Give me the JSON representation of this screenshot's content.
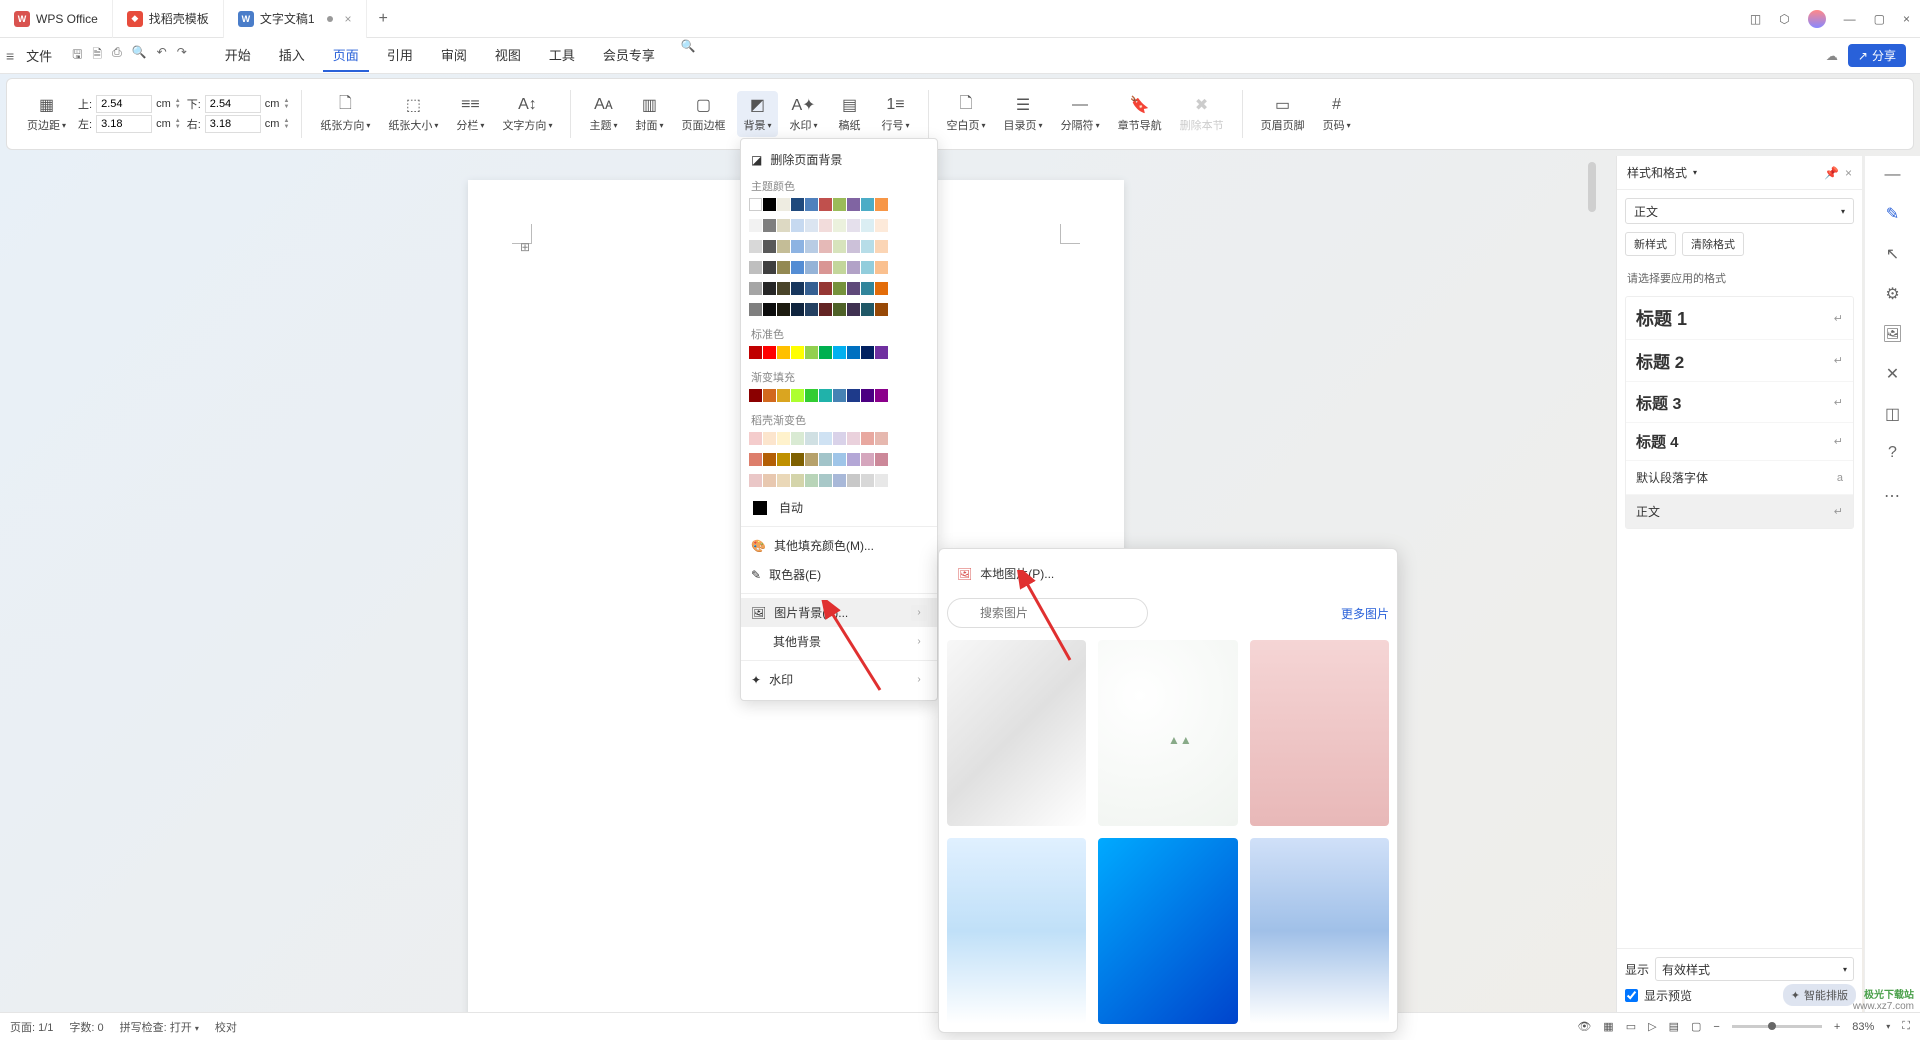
{
  "titlebar": {
    "tabs": [
      {
        "icon": "W",
        "label": "WPS Office"
      },
      {
        "icon": "D",
        "label": "找稻壳模板"
      },
      {
        "icon": "W",
        "label": "文字文稿1",
        "active": true,
        "dirty": true
      }
    ]
  },
  "menubar": {
    "file": "文件",
    "tabs": [
      "开始",
      "插入",
      "页面",
      "引用",
      "审阅",
      "视图",
      "工具",
      "会员专享"
    ],
    "active": "页面",
    "share": "分享"
  },
  "ribbon": {
    "margins": {
      "label": "页边距",
      "top_label": "上:",
      "top": "2.54",
      "unit": "cm",
      "bottom_label": "下:",
      "bottom": "2.54",
      "left_label": "左:",
      "left": "3.18",
      "right_label": "右:",
      "right": "3.18"
    },
    "items": {
      "paper_dir": "纸张方向",
      "paper_size": "纸张大小",
      "columns": "分栏",
      "text_dir": "文字方向",
      "theme": "主题",
      "cover": "封面",
      "page_border": "页面边框",
      "background": "背景",
      "watermark": "水印",
      "paper": "稿纸",
      "line_no": "行号",
      "blank_page": "空白页",
      "toc_page": "目录页",
      "separator": "分隔符",
      "chapter_nav": "章节导航",
      "delete_section": "删除本节",
      "header_footer": "页眉页脚",
      "page_no": "页码"
    }
  },
  "bg_dropdown": {
    "delete_bg": "删除页面背景",
    "theme_colors": "主题颜色",
    "standard_colors": "标准色",
    "gradient": "渐变填充",
    "docer_gradient": "稻壳渐变色",
    "auto": "自动",
    "other_fill": "其他填充颜色(M)...",
    "eyedropper": "取色器(E)",
    "picture_bg": "图片背景(P)...",
    "other_bg": "其他背景",
    "watermark": "水印"
  },
  "img_submenu": {
    "local_pic": "本地图片(P)...",
    "search_placeholder": "搜索图片",
    "more": "更多图片"
  },
  "right_panel": {
    "title": "样式和格式",
    "current_style": "正文",
    "new_style": "新样式",
    "clear_format": "清除格式",
    "hint": "请选择要应用的格式",
    "styles": [
      {
        "name": "标题 1",
        "cls": "h1"
      },
      {
        "name": "标题 2",
        "cls": "h2"
      },
      {
        "name": "标题 3",
        "cls": "h3"
      },
      {
        "name": "标题 4",
        "cls": "h4"
      },
      {
        "name": "默认段落字体",
        "cls": "def",
        "ret_label": "a"
      },
      {
        "name": "正文",
        "cls": "body",
        "selected": true
      }
    ],
    "show_label": "显示",
    "show_value": "有效样式",
    "preview": "显示预览",
    "smart_layout": "智能排版"
  },
  "statusbar": {
    "page": "页面: 1/1",
    "words": "字数: 0",
    "spell": "拼写检查: 打开",
    "proof": "校对",
    "zoom": "83%"
  },
  "watermark": {
    "brand": "极光下载站",
    "site": "www.xz7.com"
  },
  "colors": {
    "theme_row1": [
      "#ffffff",
      "#000000",
      "#eeece1",
      "#1f497d",
      "#4f81bd",
      "#c0504d",
      "#9bbb59",
      "#8064a2",
      "#4bacc6",
      "#f79646"
    ],
    "theme_grid": [
      [
        "#f2f2f2",
        "#7f7f7f",
        "#ddd9c3",
        "#c6d9f0",
        "#dbe5f1",
        "#f2dcdb",
        "#ebf1dd",
        "#e5e0ec",
        "#dbeef3",
        "#fdeada"
      ],
      [
        "#d8d8d8",
        "#595959",
        "#c4bd97",
        "#8db3e2",
        "#b8cce4",
        "#e5b9b7",
        "#d7e3bc",
        "#ccc1d9",
        "#b7dde8",
        "#fbd5b5"
      ],
      [
        "#bfbfbf",
        "#3f3f3f",
        "#938953",
        "#548dd4",
        "#95b3d7",
        "#d99694",
        "#c3d69b",
        "#b2a2c7",
        "#92cddc",
        "#fac08f"
      ],
      [
        "#a5a5a5",
        "#262626",
        "#494429",
        "#17365d",
        "#366092",
        "#953734",
        "#76923c",
        "#5f497a",
        "#31859b",
        "#e36c09"
      ],
      [
        "#7f7f7f",
        "#0c0c0c",
        "#1d1b10",
        "#0f243e",
        "#244061",
        "#632423",
        "#4f6128",
        "#3f3151",
        "#205867",
        "#974806"
      ]
    ],
    "standard": [
      "#c00000",
      "#ff0000",
      "#ffc000",
      "#ffff00",
      "#92d050",
      "#00b050",
      "#00b0f0",
      "#0070c0",
      "#002060",
      "#7030a0"
    ],
    "gradient": [
      "#8b0000",
      "#d2691e",
      "#daa520",
      "#adff2f",
      "#32cd32",
      "#20b2aa",
      "#4682b4",
      "#1e3a8a",
      "#4b0082",
      "#8b008b"
    ],
    "docer_rows": [
      [
        "#f4cccc",
        "#fce5cd",
        "#fff2cc",
        "#d9ead3",
        "#d0e0e3",
        "#cfe2f3",
        "#d9d2e9",
        "#ead1dc",
        "#e8a8a0",
        "#e6b8af"
      ],
      [
        "#dd7e6b",
        "#b45f06",
        "#bf9000",
        "#7f6000",
        "#b6a16b",
        "#a2c4c9",
        "#9fc5e8",
        "#b4a7d6",
        "#d5a6bd",
        "#cc8899"
      ],
      [
        "#eac7c7",
        "#e8c8b0",
        "#ead8b8",
        "#d4d4aa",
        "#b8d4b8",
        "#a8c8c8",
        "#a8b8d8",
        "#c8c8c8",
        "#d8d8d8",
        "#e8e8e8"
      ]
    ]
  }
}
